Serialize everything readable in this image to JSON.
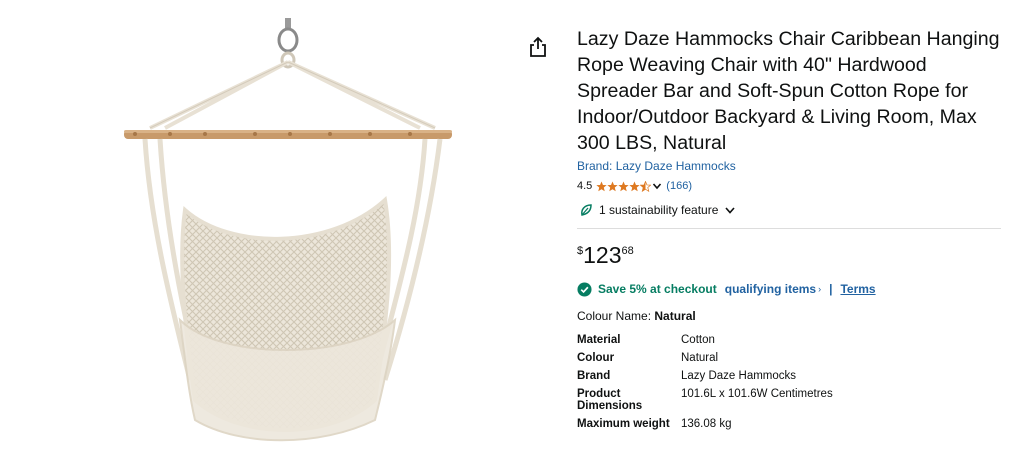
{
  "product": {
    "title": "Lazy Daze Hammocks Chair Caribbean Hanging Rope Weaving Chair with 40\" Hardwood Spreader Bar and Soft-Spun Cotton Rope for Indoor/Outdoor Backyard & Living Room, Max 300 LBS, Natural",
    "brand_link": "Brand: Lazy Daze Hammocks",
    "rating_value": "4.5",
    "rating_stars": 4.5,
    "rating_count": "(166)",
    "sustainability": "1 sustainability feature"
  },
  "price": {
    "symbol": "$",
    "whole": "123",
    "fraction": "68"
  },
  "promo": {
    "save_text": "Save 5% at checkout",
    "qualifying_link": "qualifying items",
    "qualifying_chevron": "›",
    "separator": "|",
    "terms_link": "Terms"
  },
  "colour": {
    "label": "Colour Name:",
    "value": "Natural"
  },
  "specs": [
    {
      "key": "Material",
      "value": "Cotton"
    },
    {
      "key": "Colour",
      "value": "Natural"
    },
    {
      "key": "Brand",
      "value": "Lazy Daze Hammocks"
    },
    {
      "key": "Product Dimensions",
      "value": "101.6L x 101.6W Centimetres"
    },
    {
      "key": "Maximum weight",
      "value": "136.08 kg"
    }
  ],
  "icons": {
    "share": "share-icon",
    "star": "star-icon",
    "chevron": "chevron-down-icon",
    "leaf": "leaf-icon",
    "check": "check-circle-icon"
  },
  "colors": {
    "link": "#2162a1",
    "save_green": "#067d62",
    "star": "#de7921",
    "text": "#0f1111"
  }
}
